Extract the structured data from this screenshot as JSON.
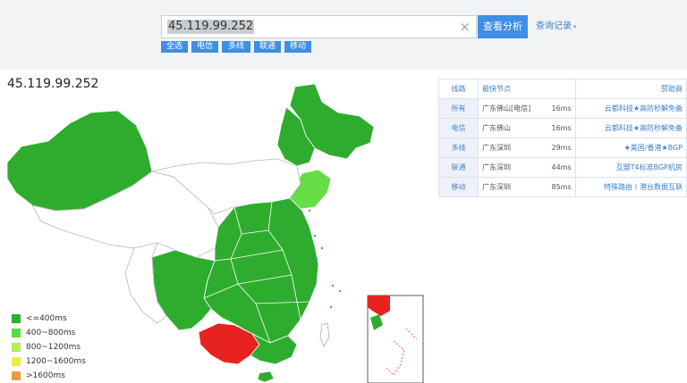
{
  "search": {
    "value": "45.119.99.252",
    "clear_icon": "×",
    "query_label": "查看分析",
    "history_label": "查询记录",
    "history_caret": "▾"
  },
  "chips": [
    "全选",
    "电信",
    "多线",
    "联通",
    "移动"
  ],
  "ip_title": "45.119.99.252",
  "colors": {
    "accent": "#3d8ee6",
    "level1": "#2eac2e",
    "level2": "#66dd44",
    "level3": "#b5ee55",
    "level4": "#eeea44",
    "level5": "#ee9944",
    "hot": "#e8221e"
  },
  "legend": [
    {
      "label": "<=400ms",
      "color": "#2eac2e"
    },
    {
      "label": "400~800ms",
      "color": "#55dd44"
    },
    {
      "label": "800~1200ms",
      "color": "#b5ee55"
    },
    {
      "label": "1200~1600ms",
      "color": "#eeea44"
    },
    {
      "label": ">1600ms",
      "color": "#ee9944"
    }
  ],
  "table": {
    "headers": {
      "line": "线路",
      "fastest": "最快节点",
      "sponsor": "赞助商"
    },
    "rows": [
      {
        "line": "所有",
        "node": "广东佛山[电信]",
        "ms": "16ms",
        "sponsor": "云都科技★高防秒解免备"
      },
      {
        "line": "电信",
        "node": "广东佛山",
        "ms": "16ms",
        "sponsor": "云都科技★高防秒解免备"
      },
      {
        "line": "多线",
        "node": "广东深圳",
        "ms": "29ms",
        "sponsor": "★美国/香港★BGP"
      },
      {
        "line": "联通",
        "node": "广东深圳",
        "ms": "44ms",
        "sponsor": "互盟T4标准BGP机房"
      },
      {
        "line": "移动",
        "node": "广东深圳",
        "ms": "85ms",
        "sponsor": "特殊路由丨港台数据互联"
      }
    ]
  }
}
